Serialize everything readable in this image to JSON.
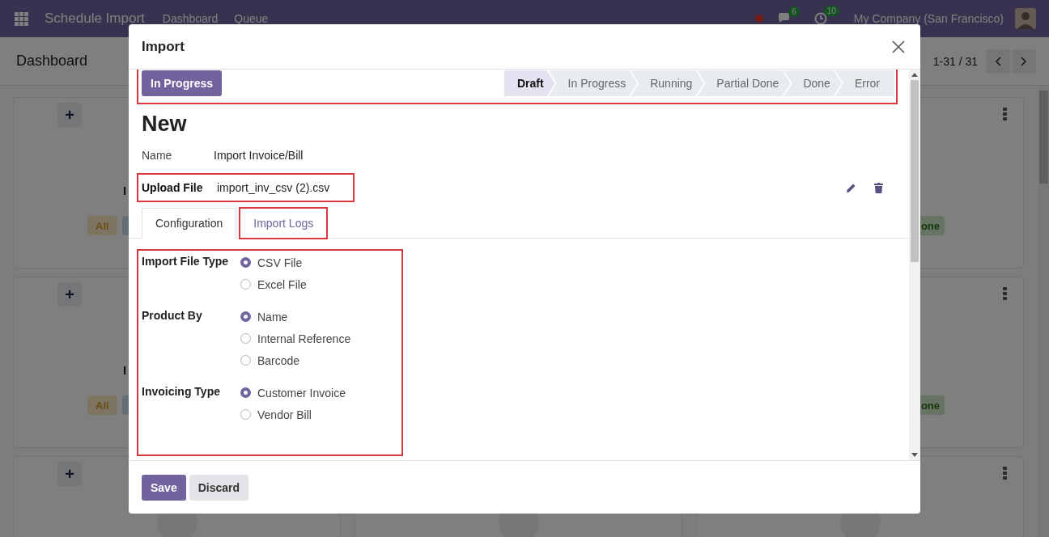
{
  "navbar": {
    "app_title": "Schedule Import",
    "menu": [
      "Dashboard",
      "Queue"
    ],
    "chat_count": "6",
    "activity_count": "10",
    "company": "My Company (San Francisco)"
  },
  "control_panel": {
    "title": "Dashboard",
    "pager": "1-31 / 31"
  },
  "kanban_rows": [
    {
      "add_symbol": "+",
      "left_title": "I",
      "left_tag": "All",
      "right_tag": "one"
    },
    {
      "add_symbol": "+",
      "left_title": "I",
      "left_tag": "All",
      "right_tag": "one"
    },
    {
      "add_symbol": "+"
    }
  ],
  "dialog": {
    "title": "Import",
    "header_highlighted": true,
    "action_button": "In Progress",
    "stages": [
      {
        "label": "Draft",
        "selected": true
      },
      {
        "label": "In Progress",
        "selected": false
      },
      {
        "label": "Running",
        "selected": false
      },
      {
        "label": "Partial Done",
        "selected": false
      },
      {
        "label": "Done",
        "selected": false
      },
      {
        "label": "Error",
        "selected": false
      }
    ],
    "record_title": "New",
    "fields": [
      {
        "kind": "text",
        "label": "Name",
        "value": "Import Invoice/Bill",
        "required": false,
        "highlighted": false
      },
      {
        "kind": "file",
        "label": "Upload File",
        "value": "import_inv_csv (2).csv",
        "required": true,
        "highlighted": true
      }
    ],
    "tabs": [
      {
        "label": "Configuration",
        "selected": true,
        "highlighted": false
      },
      {
        "label": "Import Logs",
        "selected": false,
        "highlighted": true
      }
    ],
    "options_highlighted": true,
    "option_groups": [
      {
        "label": "Import File Type",
        "options": [
          {
            "label": "CSV File",
            "selected": true
          },
          {
            "label": "Excel File",
            "selected": false
          }
        ]
      },
      {
        "label": "Product By",
        "options": [
          {
            "label": "Name",
            "selected": true
          },
          {
            "label": "Internal Reference",
            "selected": false
          },
          {
            "label": "Barcode",
            "selected": false
          }
        ]
      },
      {
        "label": "Invoicing Type",
        "options": [
          {
            "label": "Customer Invoice",
            "selected": true
          },
          {
            "label": "Vendor Bill",
            "selected": false
          }
        ]
      }
    ],
    "buttons": [
      {
        "label": "Save",
        "kind": "primary"
      },
      {
        "label": "Discard",
        "kind": "secondary"
      }
    ]
  }
}
